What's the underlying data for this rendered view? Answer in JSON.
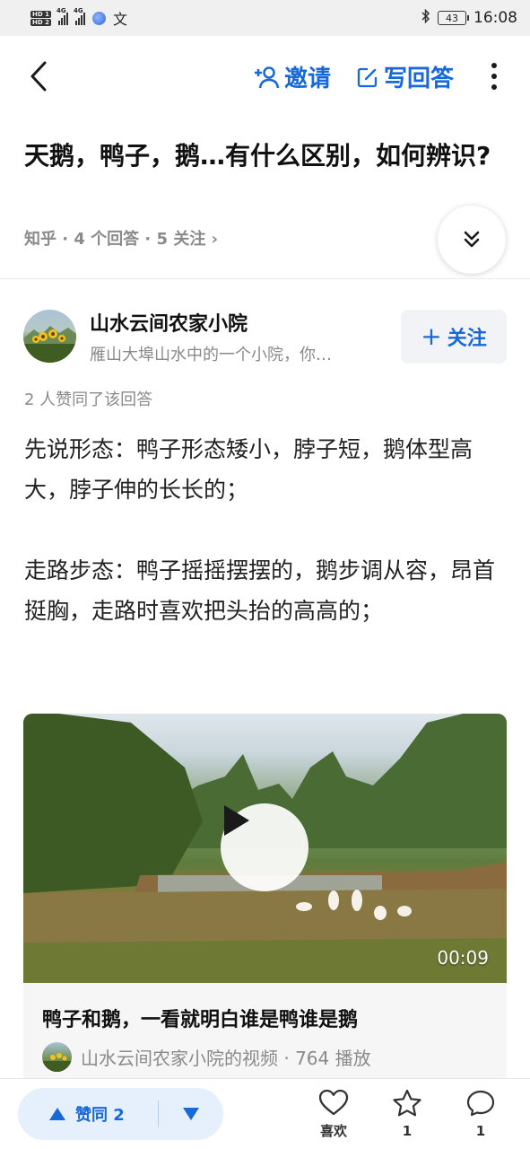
{
  "status_bar": {
    "hd1": "HD 1",
    "hd2": "HD 2",
    "net1": "4G",
    "net2": "4G",
    "translate_icon": "文",
    "battery": "43",
    "time": "16:08"
  },
  "header": {
    "invite_label": "邀请",
    "write_label": "写回答"
  },
  "question": {
    "title": "天鹅，鸭子，鹅…有什么区别，如何辨识?",
    "meta": "知乎 · 4 个回答 · 5 关注 ›"
  },
  "author": {
    "name": "山水云间农家小院",
    "bio": "雁山大埠山水中的一个小院，你…",
    "follow_label": "关注"
  },
  "answer": {
    "upvote_note": "2 人赞同了该回答",
    "paragraphs": [
      "先说形态：鸭子形态矮小，脖子短，鹅体型高大，脖子伸的长长的；",
      "走路步态：鸭子摇摇摆摆的，鹅步调从容，昂首挺胸，走路时喜欢把头抬的高高的；"
    ]
  },
  "video": {
    "duration": "00:09",
    "title": "鸭子和鹅，一看就明白谁是鸭谁是鹅",
    "source": "山水云间农家小院的视频 · 764 播放"
  },
  "bottom_bar": {
    "upvote_label": "赞同 2",
    "like_label": "喜欢",
    "favorite_count": "1",
    "comment_count": "1"
  },
  "colors": {
    "accent": "#1768d8",
    "vote_bg": "#e6f0fc",
    "muted": "#8a8a8a"
  }
}
